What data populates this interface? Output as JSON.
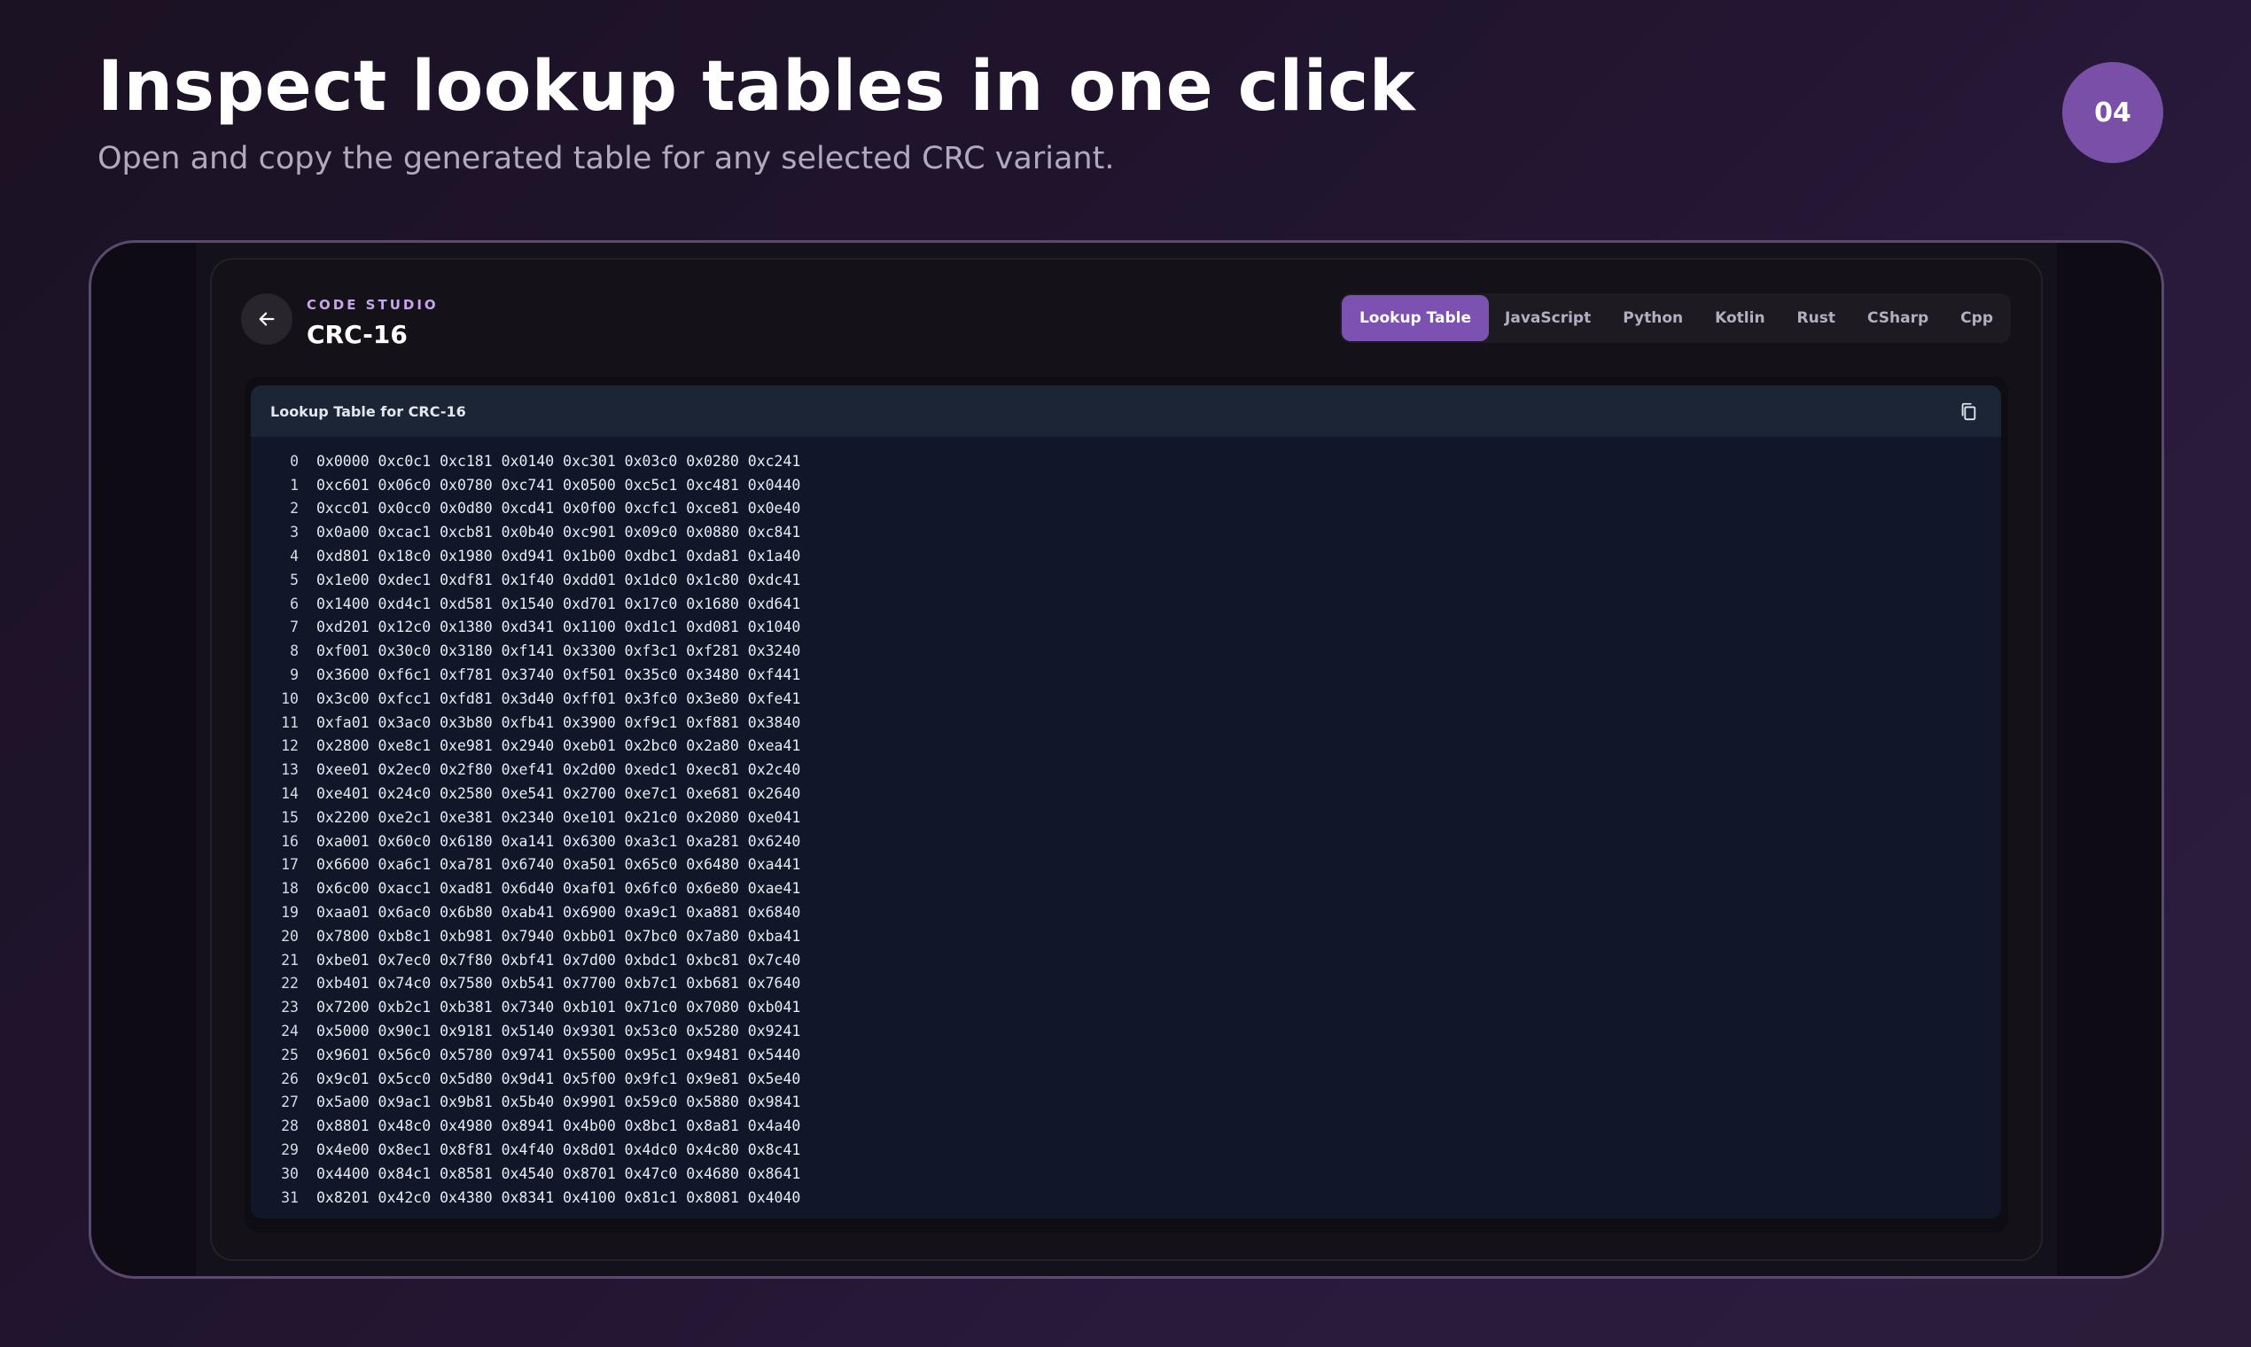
{
  "slide": {
    "title": "Inspect lookup tables in one click",
    "subtitle": "Open and copy the generated table for any selected CRC variant.",
    "badge": "04"
  },
  "header": {
    "eyebrow": "CODE STUDIO",
    "title": "CRC-16"
  },
  "tabs": [
    {
      "label": "Lookup Table",
      "active": true
    },
    {
      "label": "JavaScript",
      "active": false
    },
    {
      "label": "Python",
      "active": false
    },
    {
      "label": "Kotlin",
      "active": false
    },
    {
      "label": "Rust",
      "active": false
    },
    {
      "label": "CSharp",
      "active": false
    },
    {
      "label": "Cpp",
      "active": false
    }
  ],
  "icons": {
    "back": "arrow-left-icon",
    "copy": "copy-icon"
  },
  "colors": {
    "accent": "#7c52b0",
    "badge": "#7a4fa8",
    "eyebrow": "#c5a6ec",
    "code_bg": "#0f1729",
    "code_header_bg": "#1b2536"
  },
  "code": {
    "title": "Lookup Table for CRC-16",
    "rows": [
      {
        "num": "0",
        "text": "0x0000 0xc0c1 0xc181 0x0140 0xc301 0x03c0 0x0280 0xc241"
      },
      {
        "num": "1",
        "text": "0xc601 0x06c0 0x0780 0xc741 0x0500 0xc5c1 0xc481 0x0440"
      },
      {
        "num": "2",
        "text": "0xcc01 0x0cc0 0x0d80 0xcd41 0x0f00 0xcfc1 0xce81 0x0e40"
      },
      {
        "num": "3",
        "text": "0x0a00 0xcac1 0xcb81 0x0b40 0xc901 0x09c0 0x0880 0xc841"
      },
      {
        "num": "4",
        "text": "0xd801 0x18c0 0x1980 0xd941 0x1b00 0xdbc1 0xda81 0x1a40"
      },
      {
        "num": "5",
        "text": "0x1e00 0xdec1 0xdf81 0x1f40 0xdd01 0x1dc0 0x1c80 0xdc41"
      },
      {
        "num": "6",
        "text": "0x1400 0xd4c1 0xd581 0x1540 0xd701 0x17c0 0x1680 0xd641"
      },
      {
        "num": "7",
        "text": "0xd201 0x12c0 0x1380 0xd341 0x1100 0xd1c1 0xd081 0x1040"
      },
      {
        "num": "8",
        "text": "0xf001 0x30c0 0x3180 0xf141 0x3300 0xf3c1 0xf281 0x3240"
      },
      {
        "num": "9",
        "text": "0x3600 0xf6c1 0xf781 0x3740 0xf501 0x35c0 0x3480 0xf441"
      },
      {
        "num": "10",
        "text": "0x3c00 0xfcc1 0xfd81 0x3d40 0xff01 0x3fc0 0x3e80 0xfe41"
      },
      {
        "num": "11",
        "text": "0xfa01 0x3ac0 0x3b80 0xfb41 0x3900 0xf9c1 0xf881 0x3840"
      },
      {
        "num": "12",
        "text": "0x2800 0xe8c1 0xe981 0x2940 0xeb01 0x2bc0 0x2a80 0xea41"
      },
      {
        "num": "13",
        "text": "0xee01 0x2ec0 0x2f80 0xef41 0x2d00 0xedc1 0xec81 0x2c40"
      },
      {
        "num": "14",
        "text": "0xe401 0x24c0 0x2580 0xe541 0x2700 0xe7c1 0xe681 0x2640"
      },
      {
        "num": "15",
        "text": "0x2200 0xe2c1 0xe381 0x2340 0xe101 0x21c0 0x2080 0xe041"
      },
      {
        "num": "16",
        "text": "0xa001 0x60c0 0x6180 0xa141 0x6300 0xa3c1 0xa281 0x6240"
      },
      {
        "num": "17",
        "text": "0x6600 0xa6c1 0xa781 0x6740 0xa501 0x65c0 0x6480 0xa441"
      },
      {
        "num": "18",
        "text": "0x6c00 0xacc1 0xad81 0x6d40 0xaf01 0x6fc0 0x6e80 0xae41"
      },
      {
        "num": "19",
        "text": "0xaa01 0x6ac0 0x6b80 0xab41 0x6900 0xa9c1 0xa881 0x6840"
      },
      {
        "num": "20",
        "text": "0x7800 0xb8c1 0xb981 0x7940 0xbb01 0x7bc0 0x7a80 0xba41"
      },
      {
        "num": "21",
        "text": "0xbe01 0x7ec0 0x7f80 0xbf41 0x7d00 0xbdc1 0xbc81 0x7c40"
      },
      {
        "num": "22",
        "text": "0xb401 0x74c0 0x7580 0xb541 0x7700 0xb7c1 0xb681 0x7640"
      },
      {
        "num": "23",
        "text": "0x7200 0xb2c1 0xb381 0x7340 0xb101 0x71c0 0x7080 0xb041"
      },
      {
        "num": "24",
        "text": "0x5000 0x90c1 0x9181 0x5140 0x9301 0x53c0 0x5280 0x9241"
      },
      {
        "num": "25",
        "text": "0x9601 0x56c0 0x5780 0x9741 0x5500 0x95c1 0x9481 0x5440"
      },
      {
        "num": "26",
        "text": "0x9c01 0x5cc0 0x5d80 0x9d41 0x5f00 0x9fc1 0x9e81 0x5e40"
      },
      {
        "num": "27",
        "text": "0x5a00 0x9ac1 0x9b81 0x5b40 0x9901 0x59c0 0x5880 0x9841"
      },
      {
        "num": "28",
        "text": "0x8801 0x48c0 0x4980 0x8941 0x4b00 0x8bc1 0x8a81 0x4a40"
      },
      {
        "num": "29",
        "text": "0x4e00 0x8ec1 0x8f81 0x4f40 0x8d01 0x4dc0 0x4c80 0x8c41"
      },
      {
        "num": "30",
        "text": "0x4400 0x84c1 0x8581 0x4540 0x8701 0x47c0 0x4680 0x8641"
      },
      {
        "num": "31",
        "text": "0x8201 0x42c0 0x4380 0x8341 0x4100 0x81c1 0x8081 0x4040"
      }
    ]
  }
}
